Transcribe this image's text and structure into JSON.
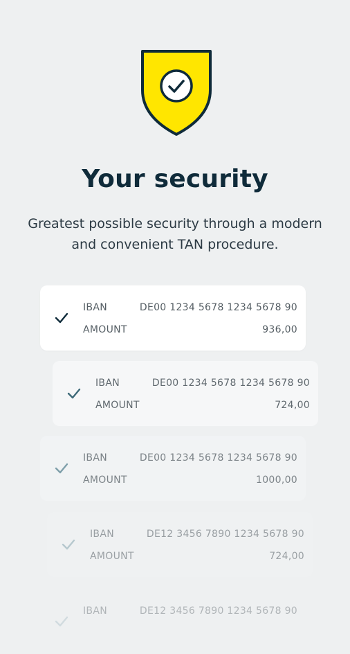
{
  "header": {
    "title": "Your security",
    "subtitle": "Greatest possible security through a modern and convenient TAN procedure."
  },
  "colors": {
    "shield_fill": "#ffe600",
    "shield_stroke": "#0f2b3a",
    "title": "#0f2b3a",
    "background": "#eef0f1"
  },
  "icons": {
    "shield": "shield-check-icon",
    "row_check": "checkmark-icon"
  },
  "cards": [
    {
      "iban_label": "IBAN",
      "iban": "DE00 1234 5678 1234 5678 90",
      "amount_label": "AMOUNT",
      "amount": "936,00"
    },
    {
      "iban_label": "IBAN",
      "iban": "DE00 1234 5678 1234 5678 90",
      "amount_label": "AMOUNT",
      "amount": "724,00"
    },
    {
      "iban_label": "IBAN",
      "iban": "DE00 1234 5678 1234 5678 90",
      "amount_label": "AMOUNT",
      "amount": "1000,00"
    },
    {
      "iban_label": "IBAN",
      "iban": "DE12 3456 7890 1234 5678 90",
      "amount_label": "AMOUNT",
      "amount": "724,00"
    },
    {
      "iban_label": "IBAN",
      "iban": "DE12 3456 7890 1234 5678 90"
    }
  ]
}
